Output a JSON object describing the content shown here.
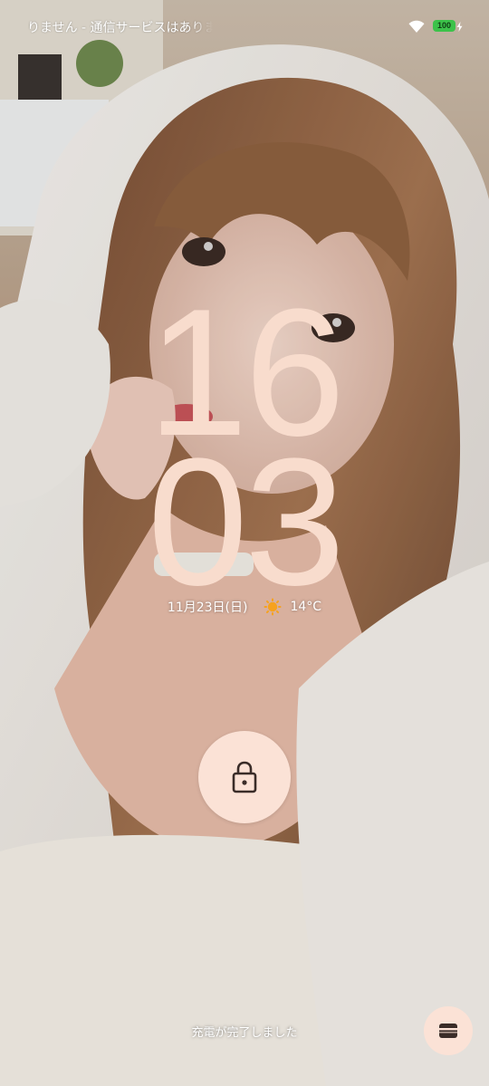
{
  "status_bar": {
    "carrier_text": "りません - 通信サービスはありませ",
    "battery_level": "100",
    "wifi_icon": "wifi-icon",
    "charging_icon": "bolt-icon"
  },
  "clock": {
    "hours": "16",
    "minutes": "03"
  },
  "date_weather": {
    "date": "11月23日(日)",
    "weather_icon": "sun-icon",
    "temperature": "14°C"
  },
  "lock": {
    "icon": "padlock-icon"
  },
  "bottom": {
    "charging_status": "充電が完了しました",
    "wallet_icon": "wallet-icon"
  },
  "colors": {
    "clock": "#f8dccd",
    "button_bg": "#fbe2d6",
    "battery": "#3cc24a"
  }
}
